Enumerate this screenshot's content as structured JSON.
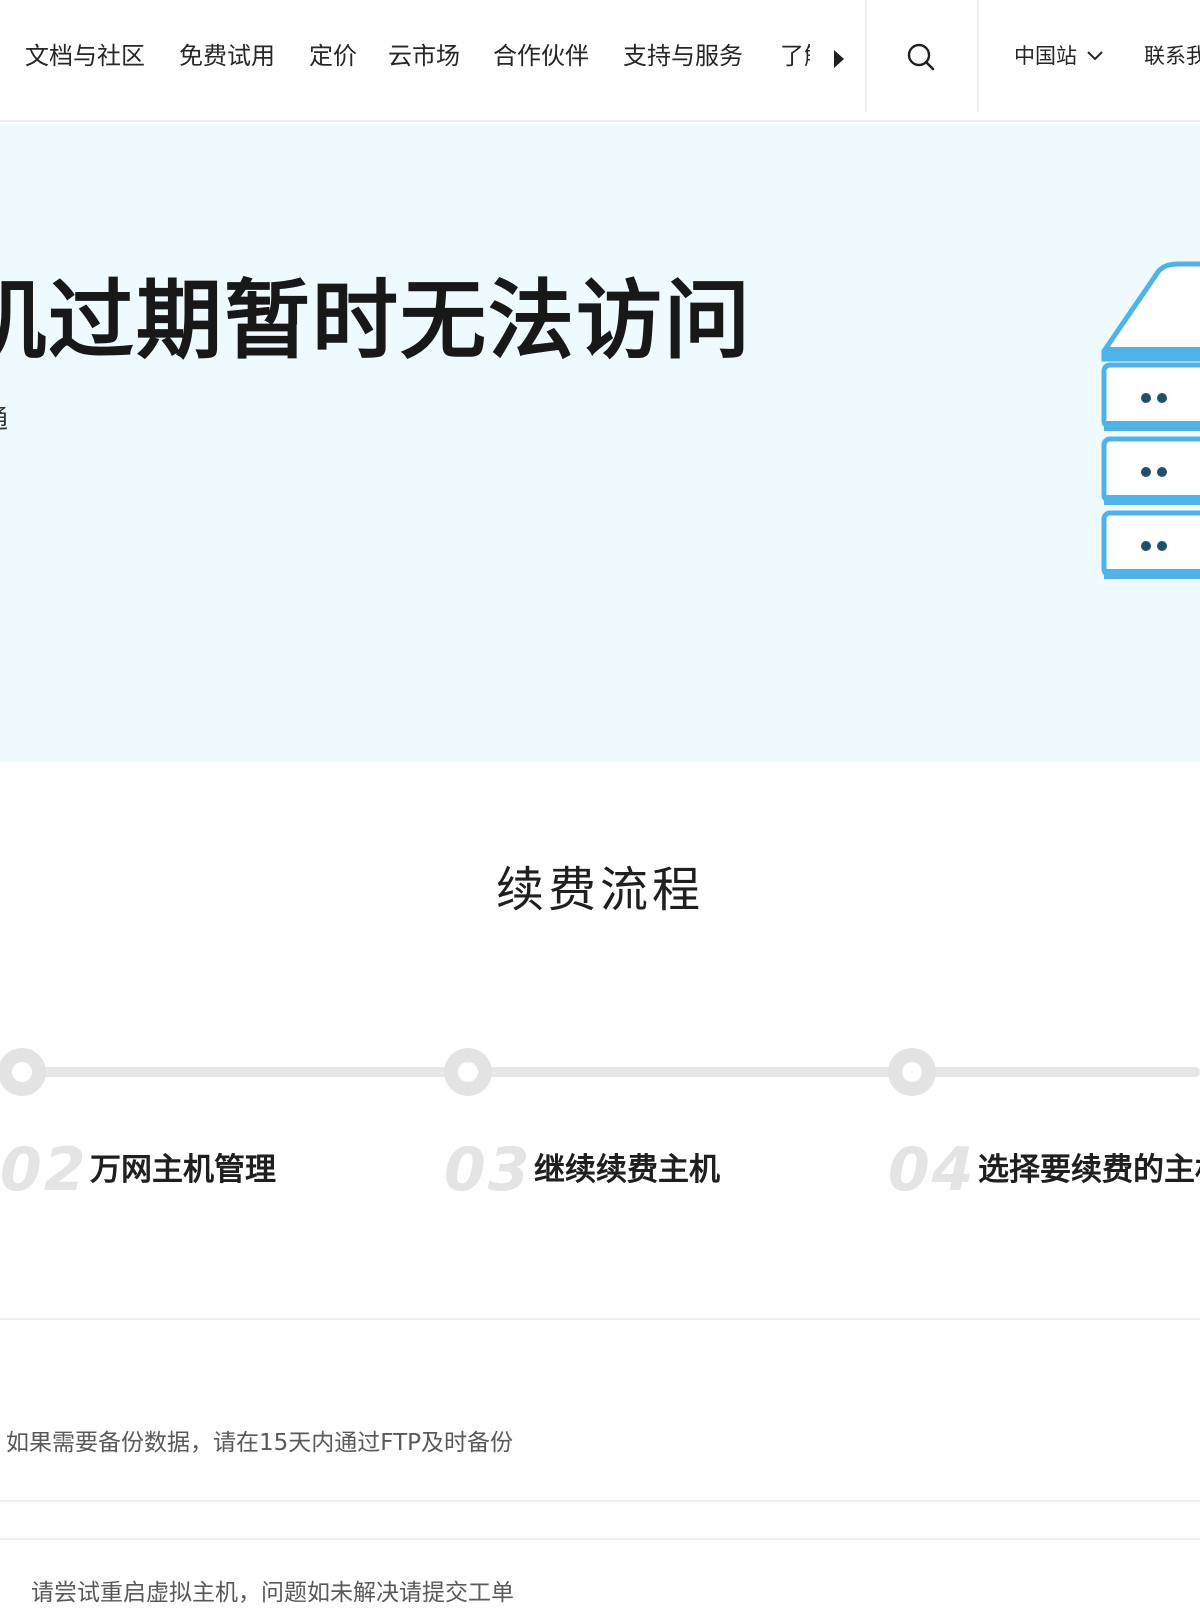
{
  "nav": {
    "items": [
      "文档与社区",
      "免费试用",
      "定价",
      "云市场",
      "合作伙伴",
      "支持与服务"
    ],
    "more_label": "了解阿里云",
    "region_label": "中国站",
    "contact_label": "联系我们"
  },
  "hero": {
    "title": "机过期暂时无法访问",
    "subtitle_fragment": "通"
  },
  "process": {
    "title": "续费流程",
    "steps": [
      {
        "num": "02",
        "label": "万网主机管理"
      },
      {
        "num": "03",
        "label": "继续续费主机"
      },
      {
        "num": "04",
        "label": "选择要续费的主机"
      }
    ]
  },
  "notes": {
    "backup": "如果需要备份数据，请在15天内通过FTP及时备份",
    "restart": "请尝试重启虚拟主机，问题如未解决请提交工单"
  },
  "colors": {
    "hero_bg": "#effaff",
    "illustration_blue": "#4fb3ea",
    "timeline_gray": "#e3e3e3"
  },
  "icons": {
    "search": "search-icon",
    "region_chevron": "chevron-down-icon",
    "nav_scroll": "caret-right-icon",
    "hero": "server-stack-illustration"
  }
}
